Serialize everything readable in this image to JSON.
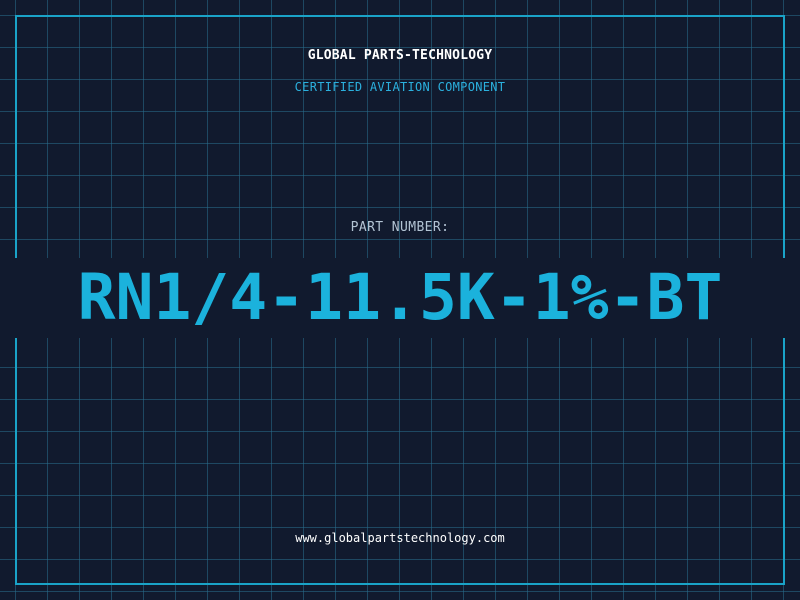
{
  "header": {
    "company": "GLOBAL PARTS-TECHNOLOGY",
    "subtitle": "CERTIFIED AVIATION COMPONENT"
  },
  "part": {
    "label": "PART NUMBER:",
    "number": "RN1/4-11.5K-1%-BT"
  },
  "footer": {
    "url": "www.globalpartstechnology.com"
  },
  "colors": {
    "background": "#111a2e",
    "grid": "#286e8c",
    "accent": "#1bb2dc",
    "frame": "#1aa3c8"
  }
}
